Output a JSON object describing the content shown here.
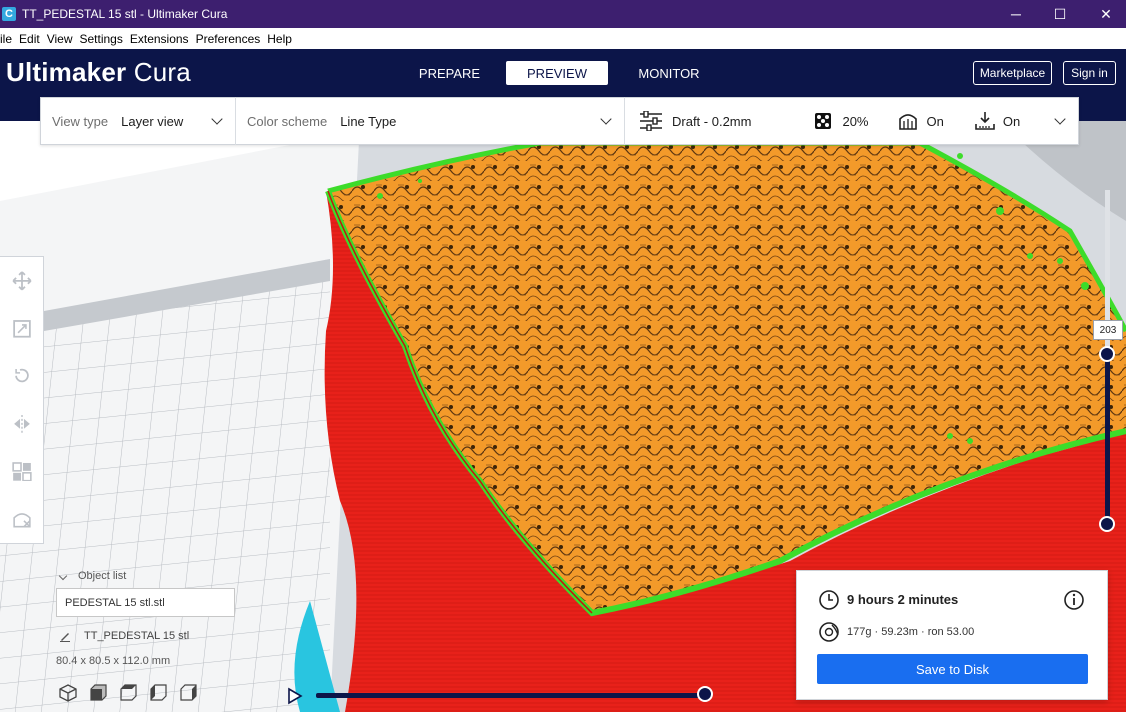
{
  "window": {
    "title": "TT_PEDESTAL 15 stl - Ultimaker Cura",
    "app_icon": "C",
    "controls": [
      "─",
      "☐",
      "✕"
    ]
  },
  "menu": [
    "ile",
    "Edit",
    "View",
    "Settings",
    "Extensions",
    "Preferences",
    "Help"
  ],
  "header": {
    "logo_bold": "Ultimaker",
    "logo_light": " Cura",
    "stages": [
      "PREPARE",
      "PREVIEW",
      "MONITOR"
    ],
    "active_stage": "PREVIEW",
    "marketplace": "Marketplace",
    "signin": "Sign in"
  },
  "toolbar": {
    "view_type_label": "View type",
    "view_type_value": "Layer view",
    "color_scheme_label": "Color scheme",
    "color_scheme_value": "Line Type",
    "profile": "Draft - 0.2mm",
    "infill": "20%",
    "support": "On",
    "adhesion": "On"
  },
  "object_list": {
    "heading": "Object list",
    "item": "PEDESTAL 15 stl.stl",
    "job_name": "TT_PEDESTAL 15 stl",
    "dimensions": "80.4 x 80.5 x 112.0 mm"
  },
  "layer_slider": {
    "current_layer": "203",
    "top_fraction": 0.81
  },
  "print_info": {
    "time": "9 hours 2 minutes",
    "material": "177g · 59.23m · ron 53.00",
    "save_button": "Save to Disk"
  },
  "colors": {
    "title_bar": "#3d1f6f",
    "header": "#0c1549",
    "accent": "#196ef0",
    "infill": "#f5a02a",
    "wall_outer": "#e8211a",
    "wall_inner": "#3ddc2a"
  }
}
